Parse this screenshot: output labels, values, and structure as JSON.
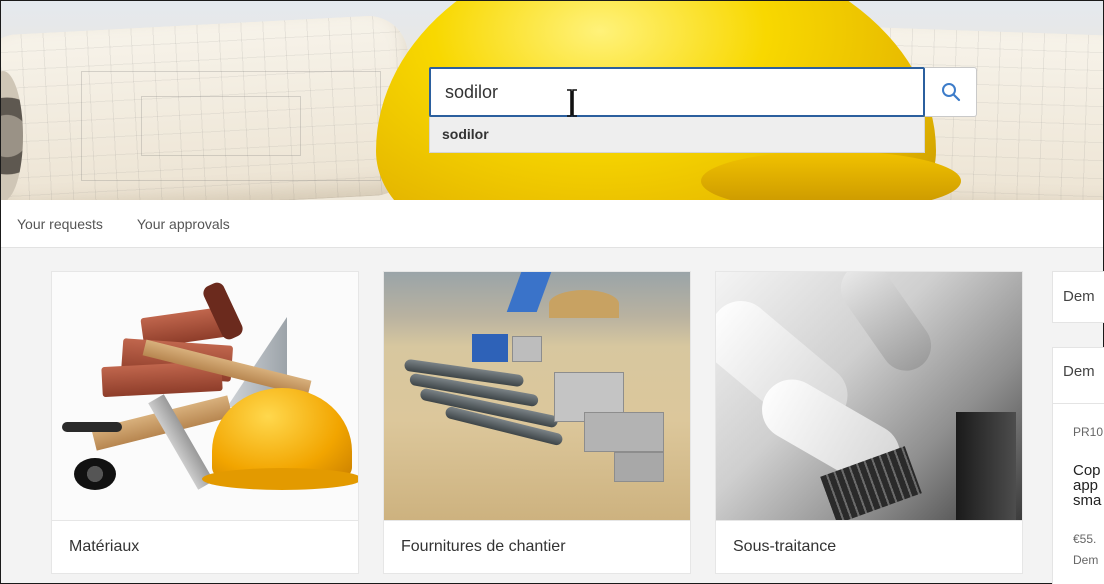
{
  "search": {
    "value": "sodilor",
    "suggestions": [
      "sodilor"
    ]
  },
  "tabs": [
    "Your requests",
    "Your approvals"
  ],
  "categories": [
    {
      "label": "Matériaux"
    },
    {
      "label": "Fournitures de chantier"
    },
    {
      "label": "Sous-traitance"
    }
  ],
  "side_panel": {
    "card1_title": "Dem",
    "card2_title": "Dem",
    "request_id": "PR10",
    "description_lines": [
      "Cop",
      "app",
      "sma"
    ],
    "price": "€55.",
    "status": "Dem"
  },
  "colors": {
    "accent": "#2b5f9e",
    "search_icon": "#3d7cc9"
  },
  "icons": {
    "search": "search-icon",
    "cursor": "text-cursor-icon"
  }
}
